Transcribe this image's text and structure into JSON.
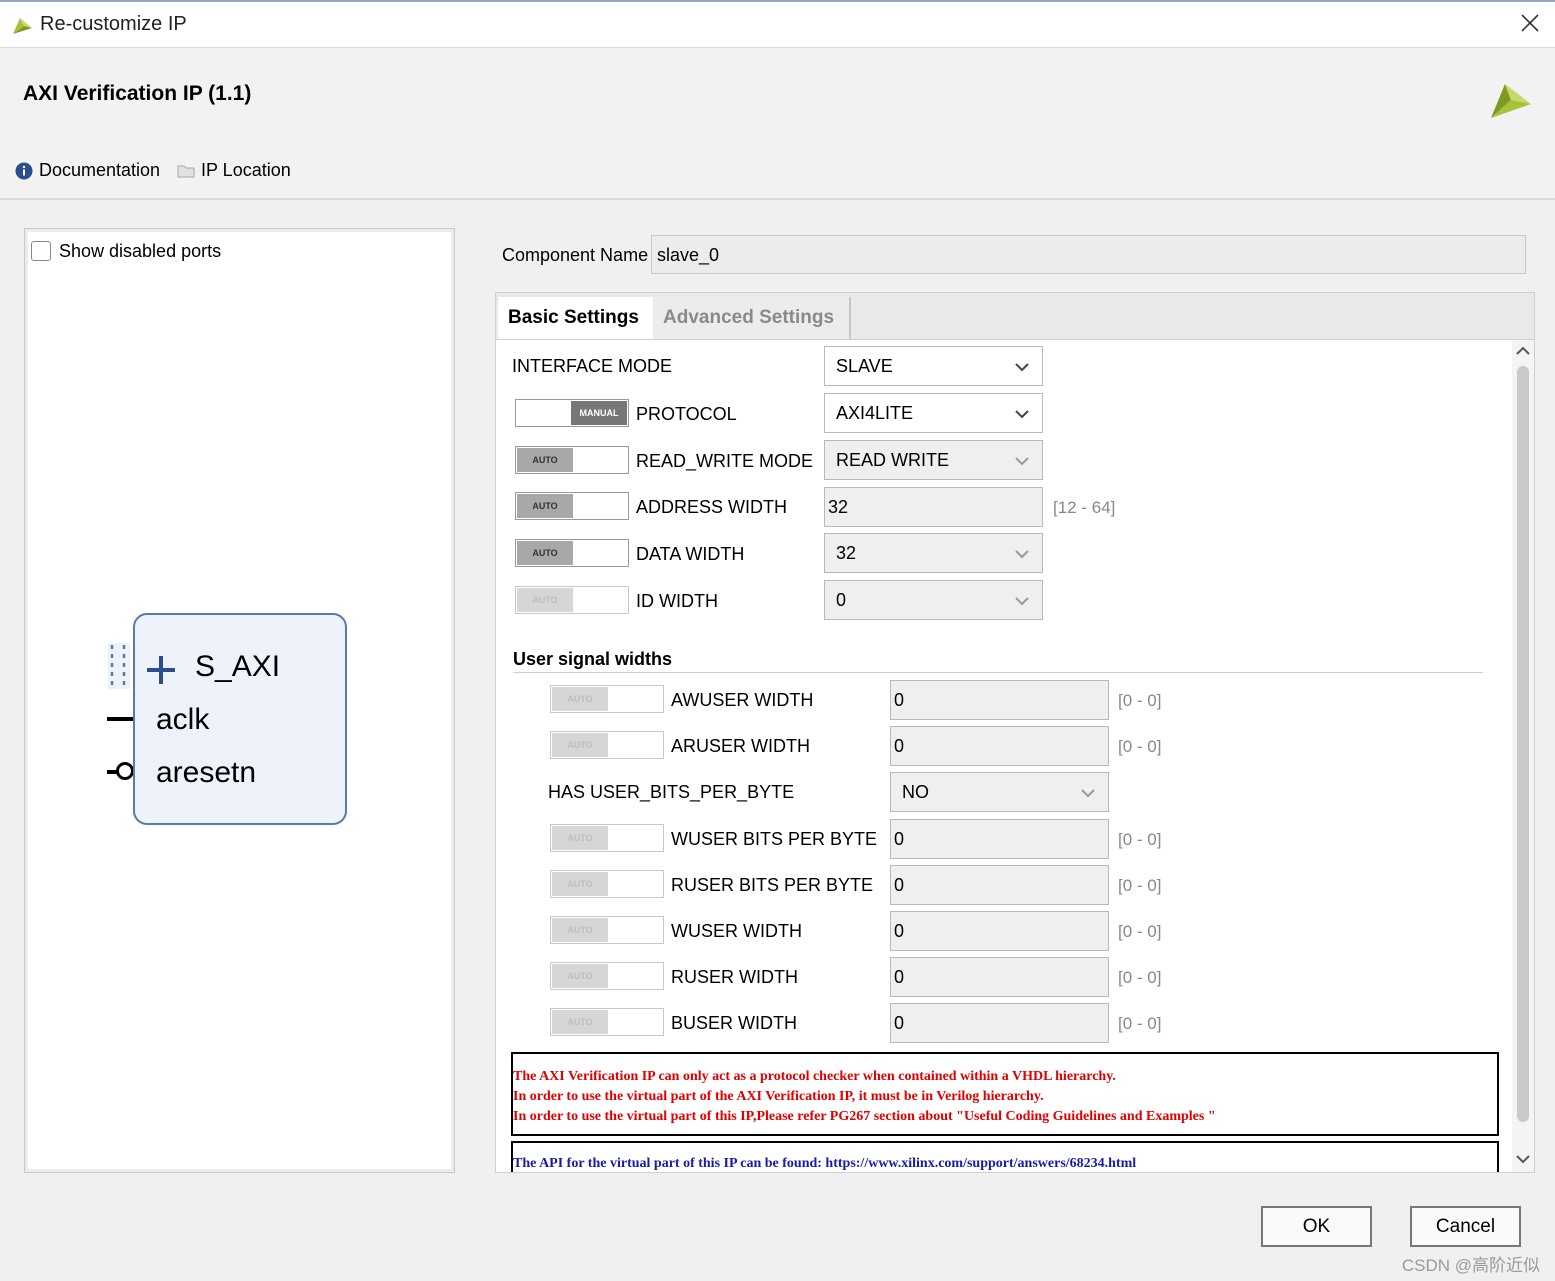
{
  "window": {
    "title": "Re-customize IP"
  },
  "header": {
    "ip_name": "AXI Verification IP (1.1)",
    "documentation": "Documentation",
    "ip_location": "IP Location"
  },
  "preview": {
    "show_disabled_ports": "Show disabled ports",
    "show_disabled_checked": false,
    "ports": {
      "s_axi": "S_AXI",
      "aclk": "aclk",
      "aresetn": "aresetn"
    }
  },
  "component": {
    "label": "Component Name",
    "value": "slave_0"
  },
  "tabs": {
    "basic": "Basic Settings",
    "advanced": "Advanced Settings"
  },
  "toggle_text": {
    "manual": "MANUAL",
    "auto": "AUTO"
  },
  "basic": {
    "interface_mode": {
      "label": "INTERFACE MODE",
      "value": "SLAVE"
    },
    "protocol": {
      "label": "PROTOCOL",
      "value": "AXI4LITE",
      "mode": "MANUAL"
    },
    "read_write_mode": {
      "label": "READ_WRITE MODE",
      "value": "READ WRITE",
      "mode": "AUTO"
    },
    "address_width": {
      "label": "ADDRESS WIDTH",
      "value": "32",
      "range": "[12 - 64]",
      "mode": "AUTO"
    },
    "data_width": {
      "label": "DATA WIDTH",
      "value": "32",
      "mode": "AUTO"
    },
    "id_width": {
      "label": "ID WIDTH",
      "value": "0",
      "mode": "AUTO"
    }
  },
  "user_signals": {
    "title": "User signal widths",
    "awuser_width": {
      "label": "AWUSER WIDTH",
      "value": "0",
      "range": "[0 - 0]"
    },
    "aruser_width": {
      "label": "ARUSER WIDTH",
      "value": "0",
      "range": "[0 - 0]"
    },
    "has_user_bits_per_byte": {
      "label": "HAS USER_BITS_PER_BYTE",
      "value": "NO"
    },
    "wuser_bits_per_byte": {
      "label": "WUSER BITS PER BYTE",
      "value": "0",
      "range": "[0 - 0]"
    },
    "ruser_bits_per_byte": {
      "label": "RUSER BITS PER BYTE",
      "value": "0",
      "range": "[0 - 0]"
    },
    "wuser_width": {
      "label": "WUSER WIDTH",
      "value": "0",
      "range": "[0 - 0]"
    },
    "ruser_width": {
      "label": "RUSER WIDTH",
      "value": "0",
      "range": "[0 - 0]"
    },
    "buser_width": {
      "label": "BUSER WIDTH",
      "value": "0",
      "range": "[0 - 0]"
    }
  },
  "notes": {
    "line1": "The AXI Verification IP can only act as a protocol checker when contained within a VHDL hierarchy.",
    "line2": "In order to use the virtual part of the AXI Verification IP, it must be in Verilog hierarchy.",
    "line3": "In order to use the virtual part of this IP,Please refer PG267 section about \"Useful Coding Guidelines and Examples \"",
    "api": "The API for the virtual part of this IP can be found: https://www.xilinx.com/support/answers/68234.html"
  },
  "buttons": {
    "ok": "OK",
    "cancel": "Cancel"
  },
  "watermark": "CSDN @高阶近似",
  "colors": {
    "note_red": "#e00000",
    "api_blue": "#1a1aa8",
    "block_border": "#5b79a8",
    "logo_green": "#a8c23a"
  }
}
